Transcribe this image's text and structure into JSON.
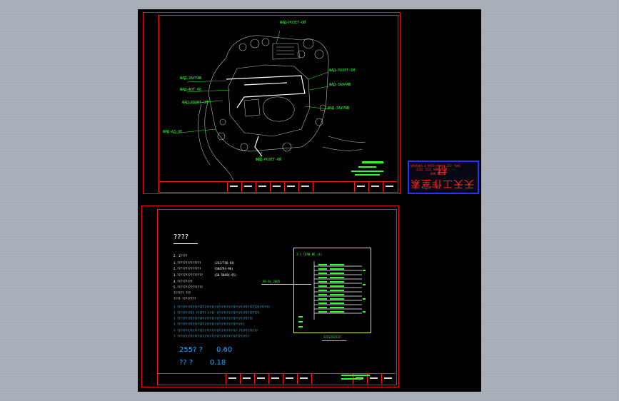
{
  "sheet1": {
    "plan_callouts": [
      {
        "text": "ФАД-РОЗЕТ-ОЙ"
      },
      {
        "text": "ФАД-ЗАУРАЮ"
      },
      {
        "text": "ФАД-ФОТ-ОБ"
      },
      {
        "text": "ФАД-РОЗЕТ-ОЙ"
      },
      {
        "text": "ФАД-АЗ-ОЕ"
      },
      {
        "text": "ФАД-РОЗЕТ-ЕМ"
      },
      {
        "text": "ФАД-ЗАУРАЮ"
      },
      {
        "text": "ФАД-ЗАУРАЮ"
      },
      {
        "text": "ФАД-РОЗЕТ-ОЙ"
      }
    ]
  },
  "sheet2": {
    "heading": "????",
    "value1_label": "255? ?",
    "value1": "0.60",
    "value2_label": "?? ?",
    "value2": "0.18",
    "schedule_title": "2-1 ГЕРИ-ИЕ (4)",
    "caption": "2222222222"
  },
  "legend": {
    "line1": "SASASAS A KOTO-PAAAA 222 *AVE",
    "line2": "2222 1212 HD02 2.4 ----",
    "line3": "0A0-VVVVV",
    "stamp": "天天工作室素材"
  }
}
